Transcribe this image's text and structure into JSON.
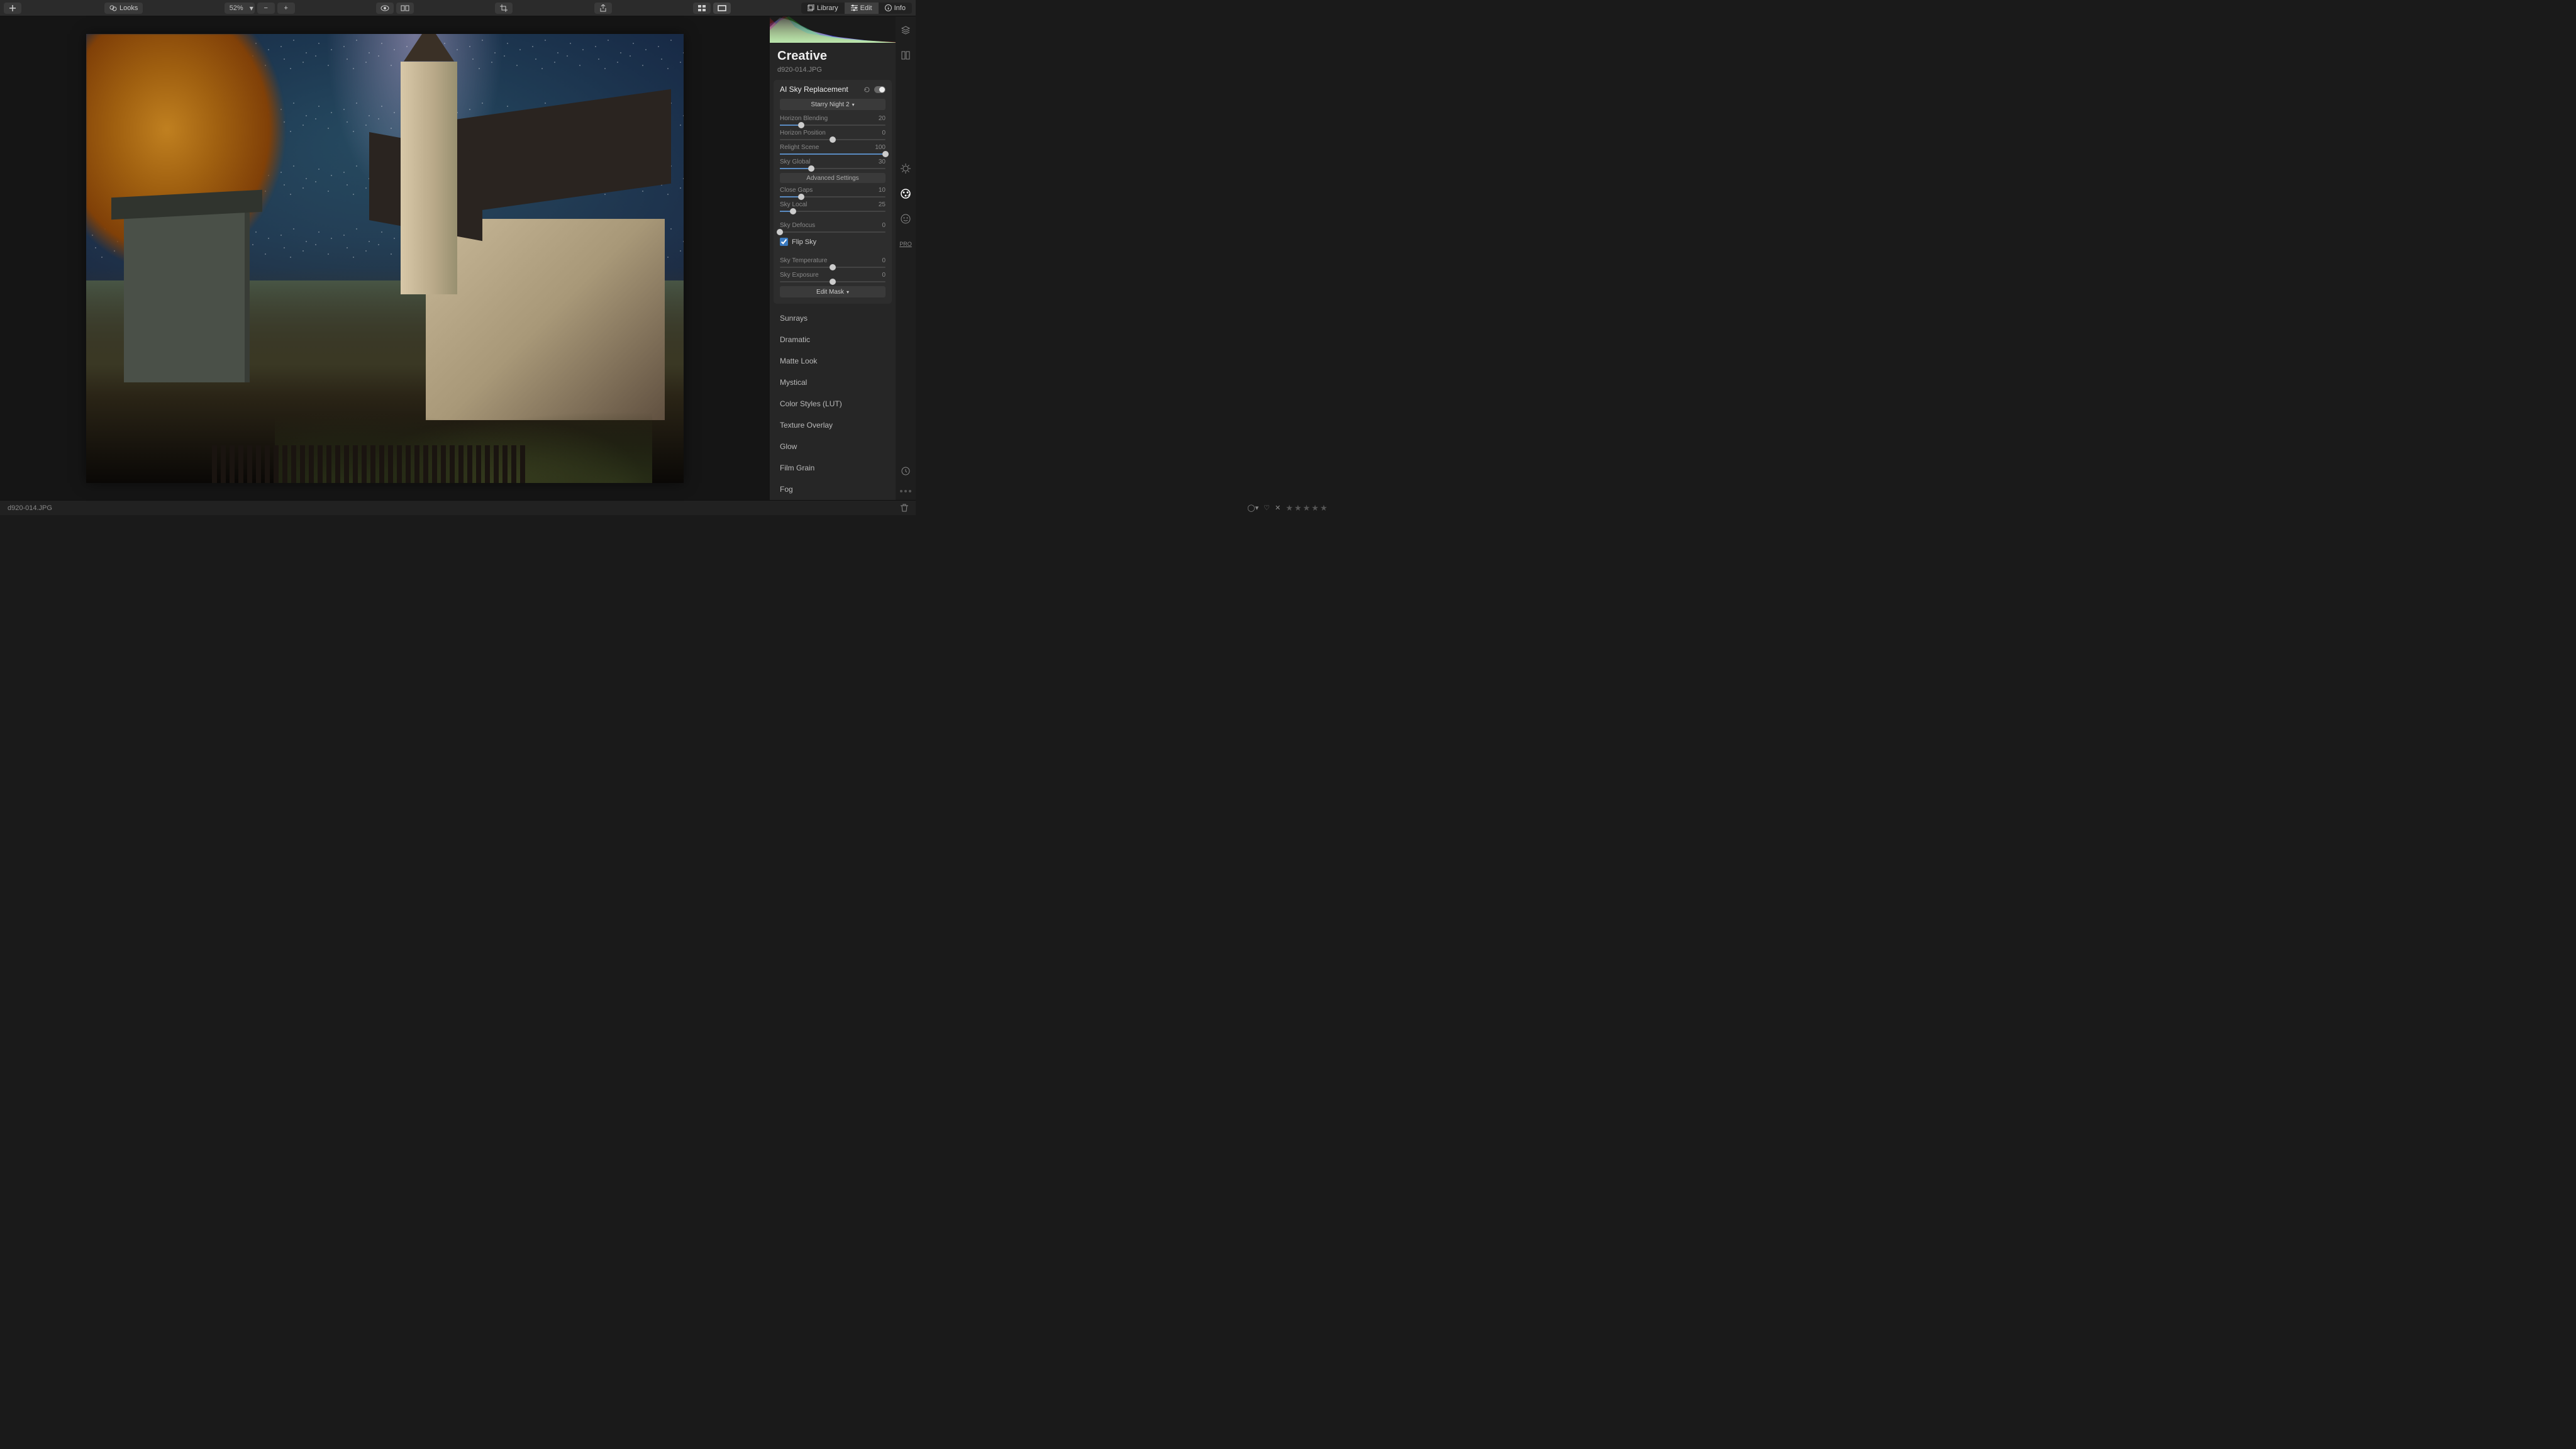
{
  "toolbar": {
    "looks_label": "Looks",
    "zoom": "52%"
  },
  "tabs": {
    "library": "Library",
    "edit": "Edit",
    "info": "Info"
  },
  "panel": {
    "title": "Creative",
    "filename": "d920-014.JPG"
  },
  "sky": {
    "title": "AI Sky Replacement",
    "preset": "Starry Night 2",
    "advanced_label": "Advanced Settings",
    "edit_mask": "Edit Mask",
    "sliders": {
      "horizon_blending": {
        "label": "Horizon Blending",
        "value": 20,
        "min": 0,
        "max": 100
      },
      "horizon_position": {
        "label": "Horizon Position",
        "value": 0,
        "min": -100,
        "max": 100
      },
      "relight_scene": {
        "label": "Relight Scene",
        "value": 100,
        "min": 0,
        "max": 100
      },
      "sky_global": {
        "label": "Sky Global",
        "value": 30,
        "min": 0,
        "max": 100
      },
      "close_gaps": {
        "label": "Close Gaps",
        "value": 10,
        "min": 0,
        "max": 50
      },
      "sky_local": {
        "label": "Sky Local",
        "value": 25,
        "min": 0,
        "max": 200
      },
      "sky_defocus": {
        "label": "Sky Defocus",
        "value": 0,
        "min": 0,
        "max": 100
      },
      "sky_temperature": {
        "label": "Sky Temperature",
        "value": 0,
        "min": -100,
        "max": 100
      },
      "sky_exposure": {
        "label": "Sky Exposure",
        "value": 0,
        "min": -100,
        "max": 100
      }
    },
    "flip_sky": {
      "label": "Flip Sky",
      "checked": true
    }
  },
  "tools": {
    "sunrays": "Sunrays",
    "dramatic": "Dramatic",
    "matte_look": "Matte Look",
    "mystical": "Mystical",
    "color_styles": "Color Styles (LUT)",
    "texture_overlay": "Texture Overlay",
    "glow": "Glow",
    "film_grain": "Film Grain",
    "fog": "Fog"
  },
  "rstrip": {
    "pro": "PRO"
  },
  "bottom": {
    "filename": "d920-014.JPG"
  }
}
